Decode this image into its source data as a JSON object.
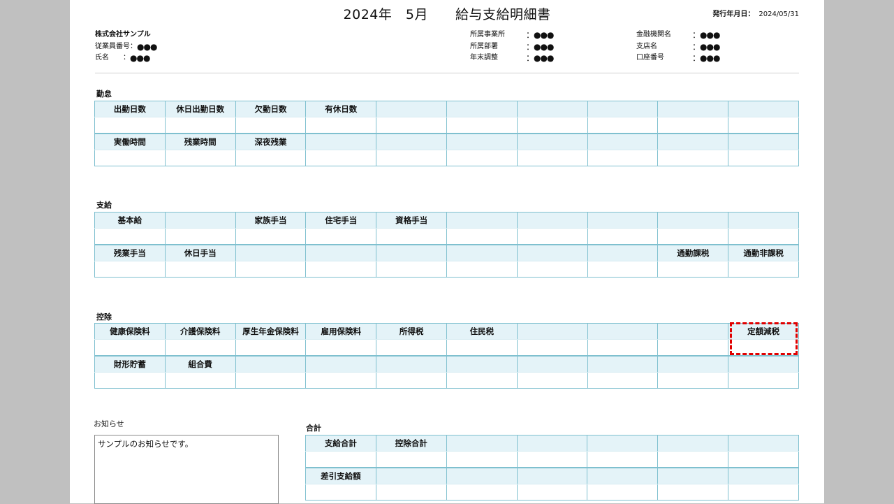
{
  "header": {
    "title": "2024年　5月　　給与支給明細書",
    "issue_label": "発行年月日：",
    "issue_date": "2024/05/31"
  },
  "employee": {
    "company": "株式会社サンプル",
    "number_label": "従業員番号：",
    "number_value": "●●●",
    "name_label": "氏名　　：",
    "name_value": "●●●"
  },
  "office": {
    "office_label": "所属事業所",
    "office_value": "：●●●",
    "dept_label": "所属部署",
    "dept_value": "：●●●",
    "yearend_label": "年末調整",
    "yearend_value": "：●●●"
  },
  "bank": {
    "bank_label": "金融機関名",
    "bank_value": "：●●●",
    "branch_label": "支店名",
    "branch_value": "：●●●",
    "account_label": "口座番号",
    "account_value": "：●●●"
  },
  "sections": {
    "attendance": "勤怠",
    "payment": "支給",
    "deduction": "控除",
    "notice": "お知らせ",
    "total": "合計"
  },
  "attendance": {
    "row1": [
      "出勤日数",
      "休日出勤日数",
      "欠勤日数",
      "有休日数",
      "",
      "",
      "",
      "",
      "",
      ""
    ],
    "row2": [
      "実働時間",
      "残業時間",
      "深夜残業",
      "",
      "",
      "",
      "",
      "",
      "",
      ""
    ]
  },
  "payment": {
    "row1": [
      "基本給",
      "",
      "家族手当",
      "住宅手当",
      "資格手当",
      "",
      "",
      "",
      "",
      ""
    ],
    "row2": [
      "残業手当",
      "休日手当",
      "",
      "",
      "",
      "",
      "",
      "",
      "通勤課税",
      "通勤非課税"
    ]
  },
  "deduction": {
    "row1": [
      "健康保険料",
      "介護保険料",
      "厚生年金保険料",
      "雇用保険料",
      "所得税",
      "住民税",
      "",
      "",
      "",
      "定額減税"
    ],
    "row2": [
      "財形貯蓄",
      "組合費",
      "",
      "",
      "",
      "",
      "",
      "",
      "",
      ""
    ]
  },
  "notice": {
    "text": "サンプルのお知らせです。"
  },
  "totals": {
    "row1": [
      "支給合計",
      "控除合計",
      "",
      "",
      "",
      "",
      ""
    ],
    "row2": [
      "差引支給額",
      "",
      "",
      "",
      "",
      "",
      ""
    ]
  },
  "colors": {
    "header_fill": "#e4f3f8",
    "border": "#7fc0cf",
    "highlight": "#e00000"
  }
}
